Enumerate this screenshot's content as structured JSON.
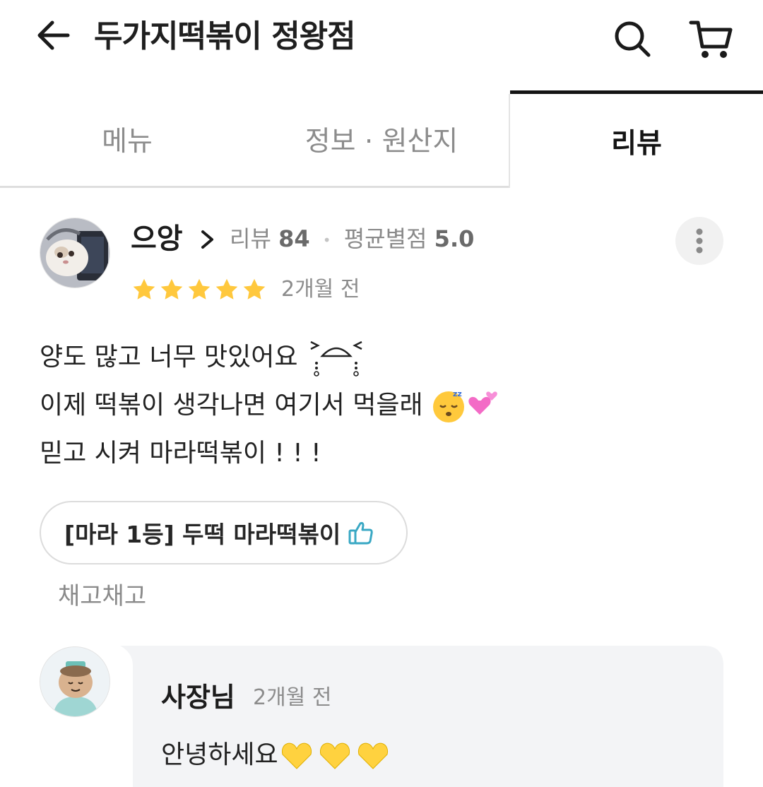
{
  "header": {
    "title": "두가지떡볶이 정왕점",
    "back_icon": "arrow-left-icon",
    "search_icon": "search-icon",
    "cart_icon": "cart-icon"
  },
  "tabs": [
    {
      "label": "메뉴",
      "active": false
    },
    {
      "label": "정보 · 원산지",
      "active": false
    },
    {
      "label": "리뷰",
      "active": true
    }
  ],
  "review": {
    "reviewer_name": "으앙",
    "stats_review_label": "리뷰",
    "stats_review_count": "84",
    "stats_separator": "•",
    "stats_rating_label": "평균별점",
    "stats_rating_value": "5.0",
    "rating": 5,
    "star_color": "#FFC83D",
    "date": "2개월 전",
    "lines": [
      "양도 많고 너무 맛있어요",
      "이제 떡볶이 생각나면 여기서 먹을래",
      "믿고 시켜 마라떡볶이 ! ! !"
    ],
    "menu_tag": "[마라 1등] 두떡 마라떡볶이",
    "hashtag": "채고채고"
  },
  "owner_reply": {
    "name": "사장님",
    "date": "2개월 전",
    "text": "안녕하세요",
    "bubble_color": "#F3F4F6"
  }
}
